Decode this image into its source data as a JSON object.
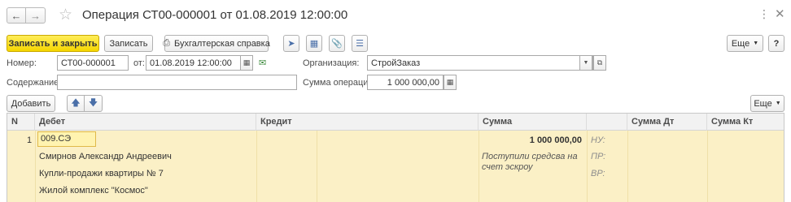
{
  "window": {
    "title": "Операция СТ00-000001 от 01.08.2019 12:00:00",
    "more_icon": "kebab-vertical-icon",
    "close_icon": "close-icon"
  },
  "toolbar": {
    "save_close_label": "Записать и закрыть",
    "save_label": "Записать",
    "report_label": "Бухгалтерская справка",
    "more_label": "Еще",
    "help_label": "?"
  },
  "form": {
    "number_label": "Номер:",
    "number_value": "СТ00-000001",
    "date_label": "от:",
    "date_value": "01.08.2019 12:00:00",
    "org_label": "Организация:",
    "org_value": "СтройЗаказ",
    "content_label": "Содержание:",
    "content_value": "",
    "sum_label": "Сумма операции:",
    "sum_value": "1 000 000,00"
  },
  "table_toolbar": {
    "add_label": "Добавить",
    "more_label": "Еще"
  },
  "table": {
    "columns": [
      "N",
      "Дебет",
      "Кредит",
      "Сумма",
      "",
      "Сумма Дт",
      "Сумма Кт"
    ],
    "rows": [
      {
        "n": "1",
        "debit": "009.СЭ",
        "debit_sub1": "Смирнов Александр Андреевич",
        "debit_sub2": "Купли-продажи квартиры № 7",
        "debit_sub3": "Жилой комплекс \"Космос\"",
        "credit": "",
        "amount": "1 000 000,00",
        "comment_line1": "Поступили средсва на",
        "comment_line2": "счет эскроу",
        "nu": "НУ:",
        "pr": "ПР:",
        "vr": "ВР:"
      }
    ]
  },
  "colors": {
    "primary_button": "#f5d600",
    "selected_row": "#fbf0c6"
  }
}
